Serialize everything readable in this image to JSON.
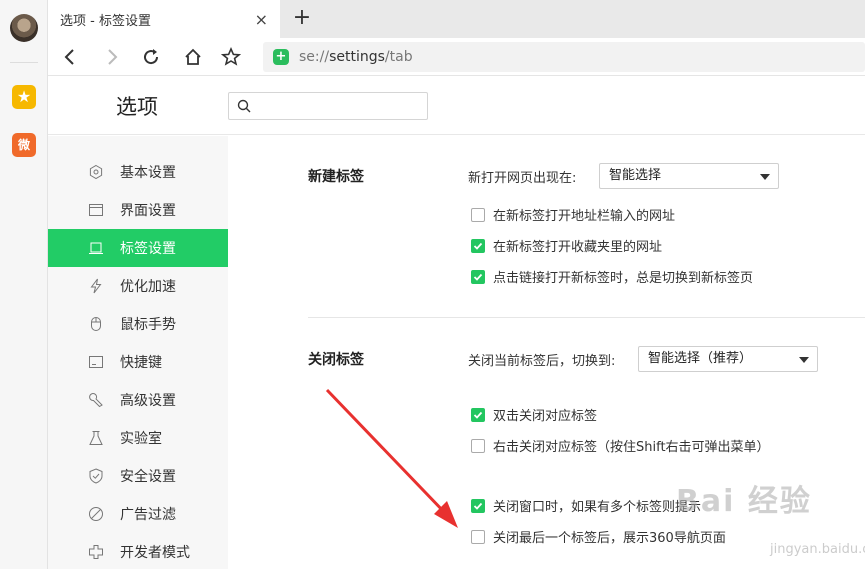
{
  "tab": {
    "title": "选项 - 标签设置",
    "close": "×",
    "new_tab": "+"
  },
  "addressbar": {
    "scheme": "se://",
    "path": "settings",
    "rest": "/tab"
  },
  "rail": {
    "fav_icon": "star-icon",
    "weibo_icon": "weibo-icon"
  },
  "header": {
    "title": "选项",
    "search_placeholder": ""
  },
  "sidebar": {
    "items": [
      {
        "label": "基本设置",
        "icon": "gear-icon"
      },
      {
        "label": "界面设置",
        "icon": "window-icon"
      },
      {
        "label": "标签设置",
        "icon": "tab-icon",
        "active": true
      },
      {
        "label": "优化加速",
        "icon": "lightning-icon"
      },
      {
        "label": "鼠标手势",
        "icon": "mouse-icon"
      },
      {
        "label": "快捷键",
        "icon": "keyboard-icon"
      },
      {
        "label": "高级设置",
        "icon": "wrench-icon"
      },
      {
        "label": "实验室",
        "icon": "flask-icon"
      },
      {
        "label": "安全设置",
        "icon": "shield-check-icon"
      },
      {
        "label": "广告过滤",
        "icon": "block-icon"
      },
      {
        "label": "开发者模式",
        "icon": "puzzle-icon"
      }
    ]
  },
  "new_tab_section": {
    "title": "新建标签",
    "open_label": "新打开网页出现在:",
    "open_select": "智能选择",
    "options": [
      {
        "label": "在新标签打开地址栏输入的网址",
        "checked": false
      },
      {
        "label": "在新标签打开收藏夹里的网址",
        "checked": true
      },
      {
        "label": "点击链接打开新标签时，总是切换到新标签页",
        "checked": true
      }
    ]
  },
  "close_tab_section": {
    "title": "关闭标签",
    "switch_label": "关闭当前标签后，切换到:",
    "switch_select": "智能选择（推荐）",
    "options": [
      {
        "label": "双击关闭对应标签",
        "checked": true
      },
      {
        "label": "右击关闭对应标签（按住Shift右击可弹出菜单）",
        "checked": false
      },
      {
        "label": "关闭窗口时，如果有多个标签则提示",
        "checked": true
      },
      {
        "label": "关闭最后一个标签后，展示360导航页面",
        "checked": false
      }
    ]
  },
  "watermark": {
    "text": "Bai 经验",
    "sub": "jingyan.baidu.com"
  },
  "colors": {
    "accent": "#22cc66",
    "arrow": "#e8312f"
  }
}
